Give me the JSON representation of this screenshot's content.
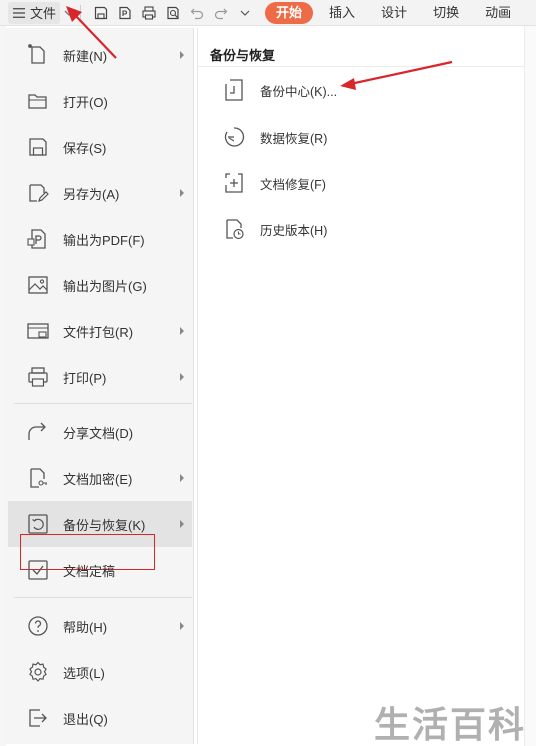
{
  "toolbar": {
    "file_label": "文件",
    "tabs": [
      "开始",
      "插入",
      "设计",
      "切换",
      "动画"
    ],
    "active_tab_color": "#ee6b48",
    "icons": [
      "save-icon",
      "export-pdf-icon",
      "print-icon",
      "preview-icon",
      "undo-icon",
      "redo-icon",
      "quick-access-dropdown-icon"
    ]
  },
  "menu": {
    "items": [
      {
        "label": "新建(N)",
        "icon": "new-doc-icon",
        "has_submenu": true
      },
      {
        "label": "打开(O)",
        "icon": "folder-open-icon",
        "has_submenu": false
      },
      {
        "label": "保存(S)",
        "icon": "save-icon",
        "has_submenu": false
      },
      {
        "label": "另存为(A)",
        "icon": "save-as-icon",
        "has_submenu": true
      },
      {
        "label": "输出为PDF(F)",
        "icon": "pdf-icon",
        "has_submenu": false
      },
      {
        "label": "输出为图片(G)",
        "icon": "image-icon",
        "has_submenu": false
      },
      {
        "label": "文件打包(R)",
        "icon": "package-icon",
        "has_submenu": true
      },
      {
        "label": "打印(P)",
        "icon": "print-icon",
        "has_submenu": true
      },
      {
        "label": "分享文档(D)",
        "icon": "share-icon",
        "has_submenu": false
      },
      {
        "label": "文档加密(E)",
        "icon": "lock-doc-icon",
        "has_submenu": true
      },
      {
        "label": "备份与恢复(K)",
        "icon": "backup-icon",
        "has_submenu": true,
        "selected": true
      },
      {
        "label": "文档定稿",
        "icon": "finalize-icon",
        "has_submenu": false
      },
      {
        "label": "帮助(H)",
        "icon": "help-icon",
        "has_submenu": true
      },
      {
        "label": "选项(L)",
        "icon": "gear-icon",
        "has_submenu": false
      },
      {
        "label": "退出(Q)",
        "icon": "exit-icon",
        "has_submenu": false
      }
    ]
  },
  "panel": {
    "title": "备份与恢复",
    "items": [
      {
        "label": "备份中心(K)...",
        "icon": "backup-center-icon"
      },
      {
        "label": "数据恢复(R)",
        "icon": "data-recovery-icon"
      },
      {
        "label": "文档修复(F)",
        "icon": "doc-repair-icon"
      },
      {
        "label": "历史版本(H)",
        "icon": "history-version-icon"
      }
    ]
  },
  "annotation_color": "#d8262a",
  "watermark": "生活百科"
}
